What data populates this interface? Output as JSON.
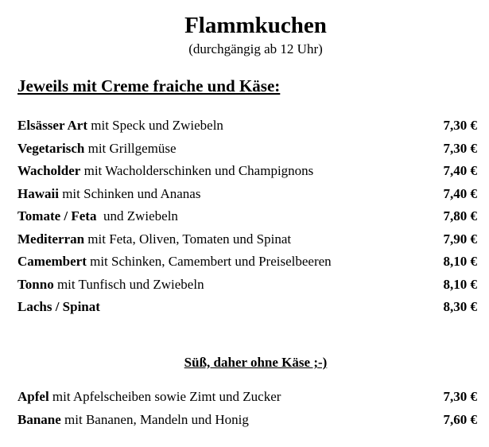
{
  "header": {
    "title": "Flammkuchen",
    "subtitle": "(durchgängig ab 12 Uhr)"
  },
  "section_savory": {
    "heading": "Jeweils mit Creme fraiche und Käse:",
    "items": [
      {
        "name": "Elsässer Art",
        "desc": " mit Speck und Zwiebeln",
        "price": "7,30 €"
      },
      {
        "name": "Vegetarisch",
        "desc": " mit Grillgemüse",
        "price": "7,30 €"
      },
      {
        "name": "Wacholder",
        "desc": " mit Wacholderschinken und Champignons",
        "price": "7,40 €"
      },
      {
        "name": "Hawaii",
        "desc": " mit Schinken und Ananas",
        "price": "7,40 €"
      },
      {
        "name": "Tomate / Feta",
        "desc": "  und Zwiebeln",
        "price": "7,80 €"
      },
      {
        "name": "Mediterran",
        "desc": " mit Feta, Oliven, Tomaten und Spinat",
        "price": "7,90 €"
      },
      {
        "name": "Camembert",
        "desc": " mit Schinken, Camembert und Preiselbeeren",
        "price": "8,10 €"
      },
      {
        "name": "Tonno",
        "desc": " mit Tunfisch und Zwiebeln",
        "price": "8,10 €"
      },
      {
        "name": "Lachs / Spinat",
        "desc": "",
        "price": "8,30 €"
      }
    ]
  },
  "section_sweet": {
    "heading": "Süß, daher ohne Käse ;-)",
    "items": [
      {
        "name": "Apfel",
        "desc": " mit Apfelscheiben sowie Zimt und Zucker",
        "price": "7,30 €"
      },
      {
        "name": "Banane",
        "desc": " mit Bananen, Mandeln und Honig",
        "price": "7,60 €"
      }
    ]
  }
}
